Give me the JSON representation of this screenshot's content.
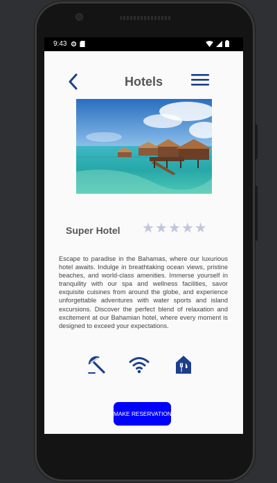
{
  "status_bar": {
    "time": "9:43",
    "icons_left": [
      "settings-icon",
      "sd-card-icon"
    ],
    "icons_right": [
      "wifi-icon",
      "signal-icon",
      "battery-icon"
    ]
  },
  "app_bar": {
    "title": "Hotels",
    "back_icon": "chevron-left-icon",
    "menu_icon": "hamburger-menu-icon"
  },
  "hotel": {
    "photo": "overwater bungalows over turquoise lagoon",
    "name": "Super Hotel",
    "rating_max": 5,
    "rating_value": 0,
    "star_glyph": "★",
    "description": "Escape to paradise in the Bahamas, where our luxurious hotel awaits. Indulge in breathtaking ocean views, pristine beaches, and world-class amenities. Immerse yourself in tranquility with our spa and wellness facilities, savor exquisite cuisines from around the globe, and experience unforgettable adventures with water sports and island excursions. Discover the perfect blend of relaxation and excitement at our Bahamian hotel, where every moment is designed to exceed your expectations."
  },
  "amenities": [
    {
      "icon": "beach-umbrella-icon"
    },
    {
      "icon": "wifi-icon"
    },
    {
      "icon": "restaurant-icon"
    }
  ],
  "reserve_button": {
    "label": "MAKE RESERVATION"
  },
  "colors": {
    "accent": "#1c3f8c",
    "button": "#0000ff",
    "star_inactive": "#c2c6dc",
    "screen_bg": "#fafafa"
  }
}
